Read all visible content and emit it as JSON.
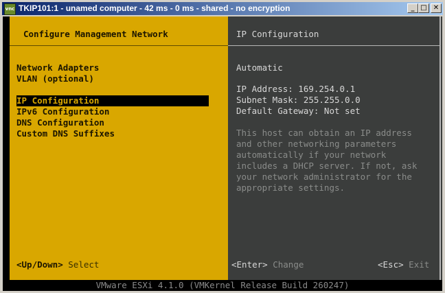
{
  "window": {
    "title": "TKIP101:1 - unamed computer - 42 ms - 0 ms - shared - no encryption",
    "icon": "vnc-icon",
    "buttons": {
      "minimize": "_",
      "maximize": "□",
      "close": "✕"
    }
  },
  "left_panel": {
    "title": "Configure Management Network",
    "menu": [
      {
        "label": "Network Adapters",
        "selected": false
      },
      {
        "label": "VLAN (optional)",
        "selected": false
      },
      {
        "label": "IP Configuration",
        "selected": true
      },
      {
        "label": "IPv6 Configuration",
        "selected": false
      },
      {
        "label": "DNS Configuration",
        "selected": false
      },
      {
        "label": "Custom DNS Suffixes",
        "selected": false
      }
    ],
    "hint_key": "<Up/Down>",
    "hint_action": "Select"
  },
  "right_panel": {
    "title": "IP Configuration",
    "mode": "Automatic",
    "ip_address": "IP Address: 169.254.0.1",
    "subnet_mask": "Subnet Mask: 255.255.0.0",
    "default_gateway": "Default Gateway: Not set",
    "description": [
      "This host can obtain an IP address",
      "and other networking parameters",
      "automatically if your network",
      "includes a DHCP server. If not, ask",
      "your network administrator for the",
      "appropriate settings."
    ],
    "enter_key": "<Enter>",
    "enter_action": "Change",
    "esc_key": "<Esc>",
    "esc_action": "Exit"
  },
  "footer": "VMware ESXi 4.1.0 (VMKernel Release Build 260247)",
  "colors": {
    "accent": "#d9a700",
    "panel_dark": "#3b3d3c",
    "titlebar": "#0a246a"
  }
}
